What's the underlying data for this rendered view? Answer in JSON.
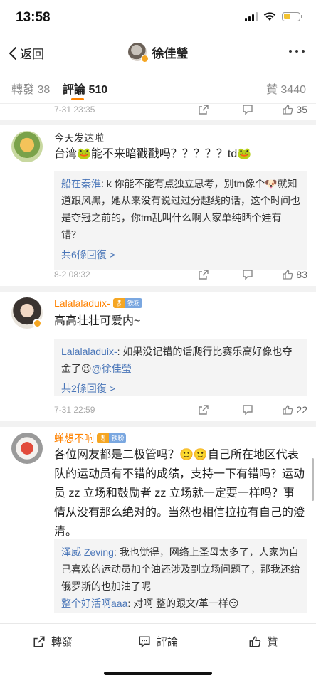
{
  "status_bar": {
    "time": "13:58"
  },
  "nav": {
    "back_label": "返回",
    "title": "徐佳瑩"
  },
  "tabs": {
    "repost_label": "轉發",
    "repost_count": "38",
    "comment_label": "評論",
    "comment_count": "510",
    "like_label": "贊",
    "like_count": "3440"
  },
  "comments": [
    {
      "time": "7-31 23:35",
      "likes": "35"
    },
    {
      "author": "今天发达啦",
      "text": "台湾🐸能不来暗戳戳吗？？？？？td🐸",
      "reply_name": "船在秦淮",
      "reply_text": ": k  你能不能有点独立思考，别tm像个🐶就知道跟风黑，她从来没有说过过分越线的话，这个时间也是夺冠之前的，你tm乱叫什么啊人家单纯晒个娃有错？",
      "more_replies": "共6條回復 >",
      "time": "8-2 08:32",
      "likes": "83"
    },
    {
      "author": "Lalalaladuix-",
      "text": "高高壮壮可爱内~",
      "reply_name": "Lalalaladuix-",
      "reply_text": ": 如果没记错的话爬行比赛乐高好像也夺金了😉",
      "reply_mention": "@徐佳瑩",
      "more_replies": "共2條回復 >",
      "time": "7-31 22:59",
      "likes": "22"
    },
    {
      "author": "蝉想不响",
      "text": "各位网友都是二极管吗？🙂🙂自己所在地区代表队的运动员有不错的成绩，支持一下有错吗？运动员 zz 立场和鼓励者 zz 立场就一定要一样吗？事情从没有那么绝对的。当然也相信拉拉有自己的澄清。",
      "reply1_name": "泽威 Zeving",
      "reply1_text": ": 我也觉得，网络上圣母太多了，人家为自己喜欢的运动员加个油还涉及到立场问题了，那我还给俄罗斯的也加油了呢",
      "reply2_name": "整个好活啊aaa",
      "reply2_text": ": 对啊 整的跟文/革一样😏"
    }
  ],
  "fan_badge": {
    "left": "🎖",
    "right": "铁粉"
  },
  "bottom_bar": {
    "repost": "轉發",
    "comment": "評論",
    "like": "贊"
  },
  "colors": {
    "accent": "#ff8200",
    "link": "#4a76b8",
    "tab_underline": "#ff8200"
  }
}
